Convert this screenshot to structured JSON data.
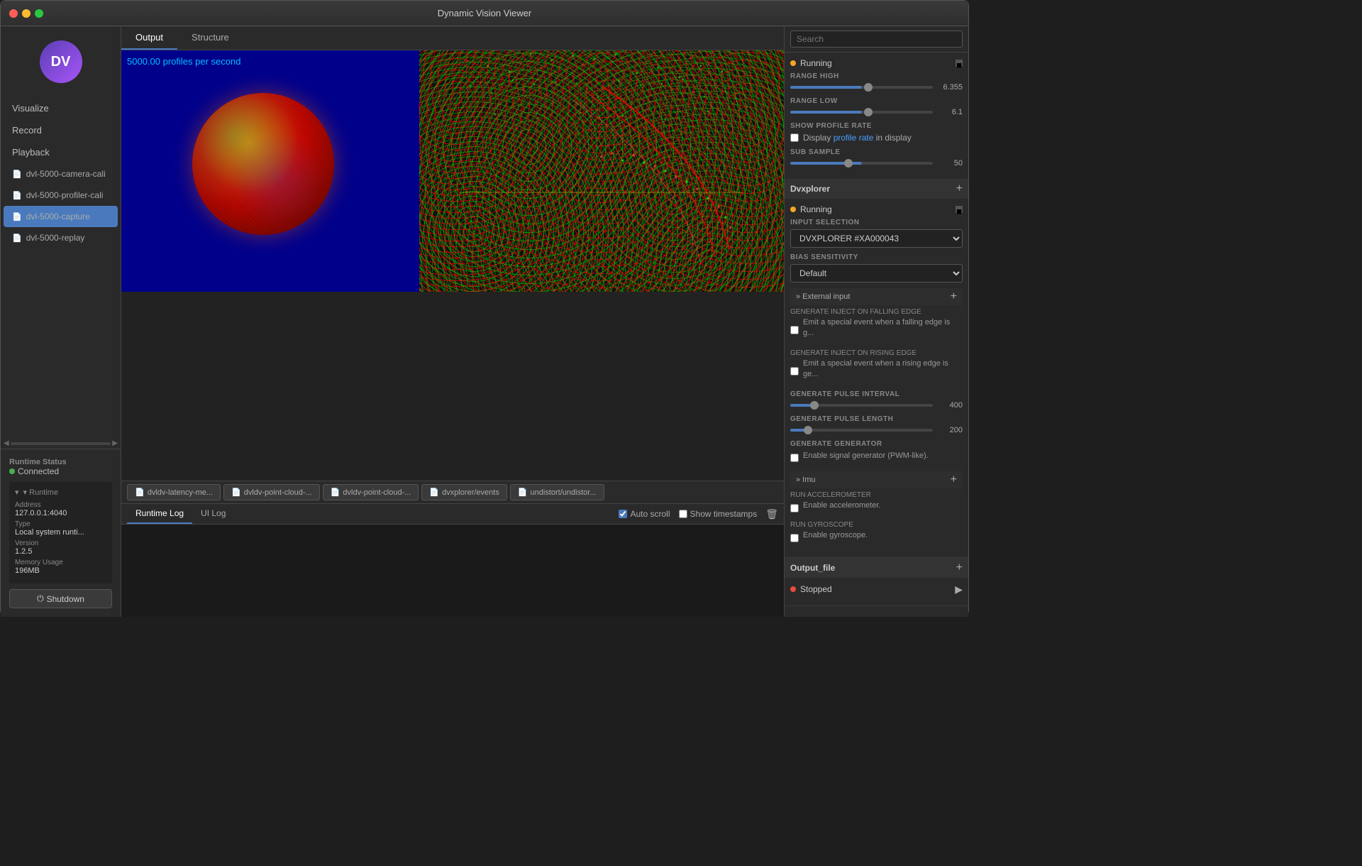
{
  "titlebar": {
    "title": "Dynamic Vision Viewer",
    "icon": "DV"
  },
  "sidebar": {
    "logo_text": "DV",
    "nav_items": [
      {
        "label": "Visualize",
        "id": "visualize",
        "active": false
      },
      {
        "label": "Record",
        "id": "record",
        "active": false
      },
      {
        "label": "Playback",
        "id": "playback",
        "active": false
      }
    ],
    "files": [
      {
        "label": "dvl-5000-camera-cali",
        "id": "file1"
      },
      {
        "label": "dvl-5000-profiler-cali",
        "id": "file2"
      },
      {
        "label": "dvl-5000-capture",
        "id": "file3",
        "active": true
      },
      {
        "label": "dvl-5000-replay",
        "id": "file4"
      }
    ],
    "scroll_hint": "◀ ▶",
    "runtime_status": {
      "label": "Runtime Status",
      "connected": "Connected",
      "runtime_label": "▾ Runtime",
      "address_label": "Address",
      "address_value": "127.0.0.1:4040",
      "type_label": "Type",
      "type_value": "Local system runti...",
      "version_label": "Version",
      "version_value": "1.2.5",
      "memory_label": "Memory Usage",
      "memory_value": "196MB",
      "shutdown_label": "Shutdown"
    }
  },
  "main_tabs": [
    {
      "label": "Output",
      "active": true
    },
    {
      "label": "Structure",
      "active": false
    }
  ],
  "viewer": {
    "fps_text": "5000.00 profiles per second"
  },
  "module_tabs": [
    {
      "label": "dvldv-latency-me...",
      "icon": "📄"
    },
    {
      "label": "dvldv-point-cloud-...",
      "icon": "📄"
    },
    {
      "label": "dvldv-point-cloud-...",
      "icon": "📄"
    },
    {
      "label": "dvxplorer/events",
      "icon": "📄"
    },
    {
      "label": "undistort/undistor...",
      "icon": "📄"
    }
  ],
  "log": {
    "tabs": [
      {
        "label": "Runtime Log",
        "active": true
      },
      {
        "label": "UI Log",
        "active": false
      }
    ],
    "auto_scroll_label": "Auto scroll",
    "timestamps_label": "Show timestamps",
    "clear_icon": "🗑"
  },
  "right_panel": {
    "search_placeholder": "Search",
    "main_status": {
      "status": "Running",
      "stop_icon": "■"
    },
    "range_high": {
      "label": "RANGE HIGH",
      "value": "6.355",
      "slider_pct": 55
    },
    "range_low": {
      "label": "RANGE LOW",
      "value": "6.1",
      "slider_pct": 55
    },
    "show_profile_rate": {
      "label": "SHOW PROFILE RATE",
      "checkbox_label": "Display profile rate in display"
    },
    "sub_sample": {
      "label": "SUB SAMPLE",
      "value": "50",
      "slider_pct": 40
    },
    "dvxplorer": {
      "title": "Dvxplorer",
      "status": "Running",
      "stop_icon": "■",
      "input_selection_label": "INPUT SELECTION",
      "input_selection_value": "DVXPLORER #XA000043",
      "input_options": [
        "DVXPLORER #XA000043"
      ],
      "bias_sensitivity_label": "BIAS SENSITIVITY",
      "bias_sensitivity_value": "Default",
      "bias_options": [
        "Default"
      ],
      "external_input": {
        "title": "» External input",
        "generate_falling_label": "GENERATE INJECT ON FALLING EDGE",
        "generate_falling_desc": "Emit a special event when a falling edge is g...",
        "generate_rising_label": "GENERATE INJECT ON RISING EDGE",
        "generate_rising_desc": "Emit a special event when a rising edge is ge...",
        "generate_pulse_interval_label": "GENERATE PULSE INTERVAL",
        "generate_pulse_interval_value": "400",
        "generate_pulse_length_label": "GENERATE PULSE LENGTH",
        "generate_pulse_length_value": "200"
      },
      "generate_label": "GENERATE GENERATOR",
      "generate_desc": "Enable signal generator (PWM-like).",
      "imu": {
        "title": "» Imu",
        "accelerometer_label": "RUN ACCELEROMETER",
        "accelerometer_desc": "Enable accelerometer.",
        "gyroscope_label": "RUN GYROSCOPE",
        "gyroscope_desc": "Enable gyroscope."
      }
    },
    "output_file": {
      "title": "Output_file",
      "status": "Stopped"
    }
  }
}
